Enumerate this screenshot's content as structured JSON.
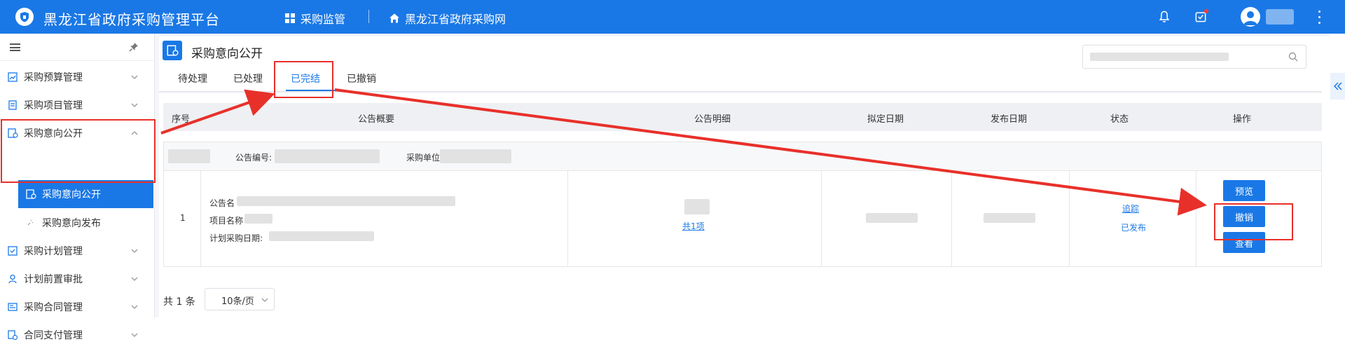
{
  "topbar": {
    "app_title": "黑龙江省政府采购管理平台",
    "nav_supervision": "采购监管",
    "nav_website": "黑龙江省政府采购网"
  },
  "sidebar": {
    "items": [
      {
        "label": "采购预算管理"
      },
      {
        "label": "采购项目管理"
      },
      {
        "label": "采购意向公开"
      },
      {
        "label": "采购计划管理"
      },
      {
        "label": "计划前置审批"
      },
      {
        "label": "采购合同管理"
      },
      {
        "label": "合同支付管理"
      }
    ],
    "sub_active": "采购意向公开",
    "sub_publish": "采购意向发布"
  },
  "page": {
    "title": "采购意向公开",
    "tabs": [
      "待处理",
      "已处理",
      "已完结",
      "已撤销"
    ],
    "active_tab": "已完结"
  },
  "table": {
    "headers": [
      "序号",
      "公告概要",
      "公告明细",
      "拟定日期",
      "发布日期",
      "状态",
      "操作"
    ],
    "group": {
      "notice_no_label": "公告编号:",
      "unit_label": "采购单位"
    },
    "row": {
      "index": "1",
      "notice_name_label": "公告名",
      "project_name_label": "项目名称",
      "plan_date_label": "计划采购日期:",
      "detail_link": "共1项",
      "track_link": "追踪",
      "status": "已发布",
      "buttons": {
        "preview": "预览",
        "revoke": "撤销",
        "view": "查看"
      }
    }
  },
  "footer": {
    "total": "共 1 条",
    "page_size": "10条/页"
  },
  "colors": {
    "primary": "#1a78e6",
    "annotation": "#e8302a"
  }
}
